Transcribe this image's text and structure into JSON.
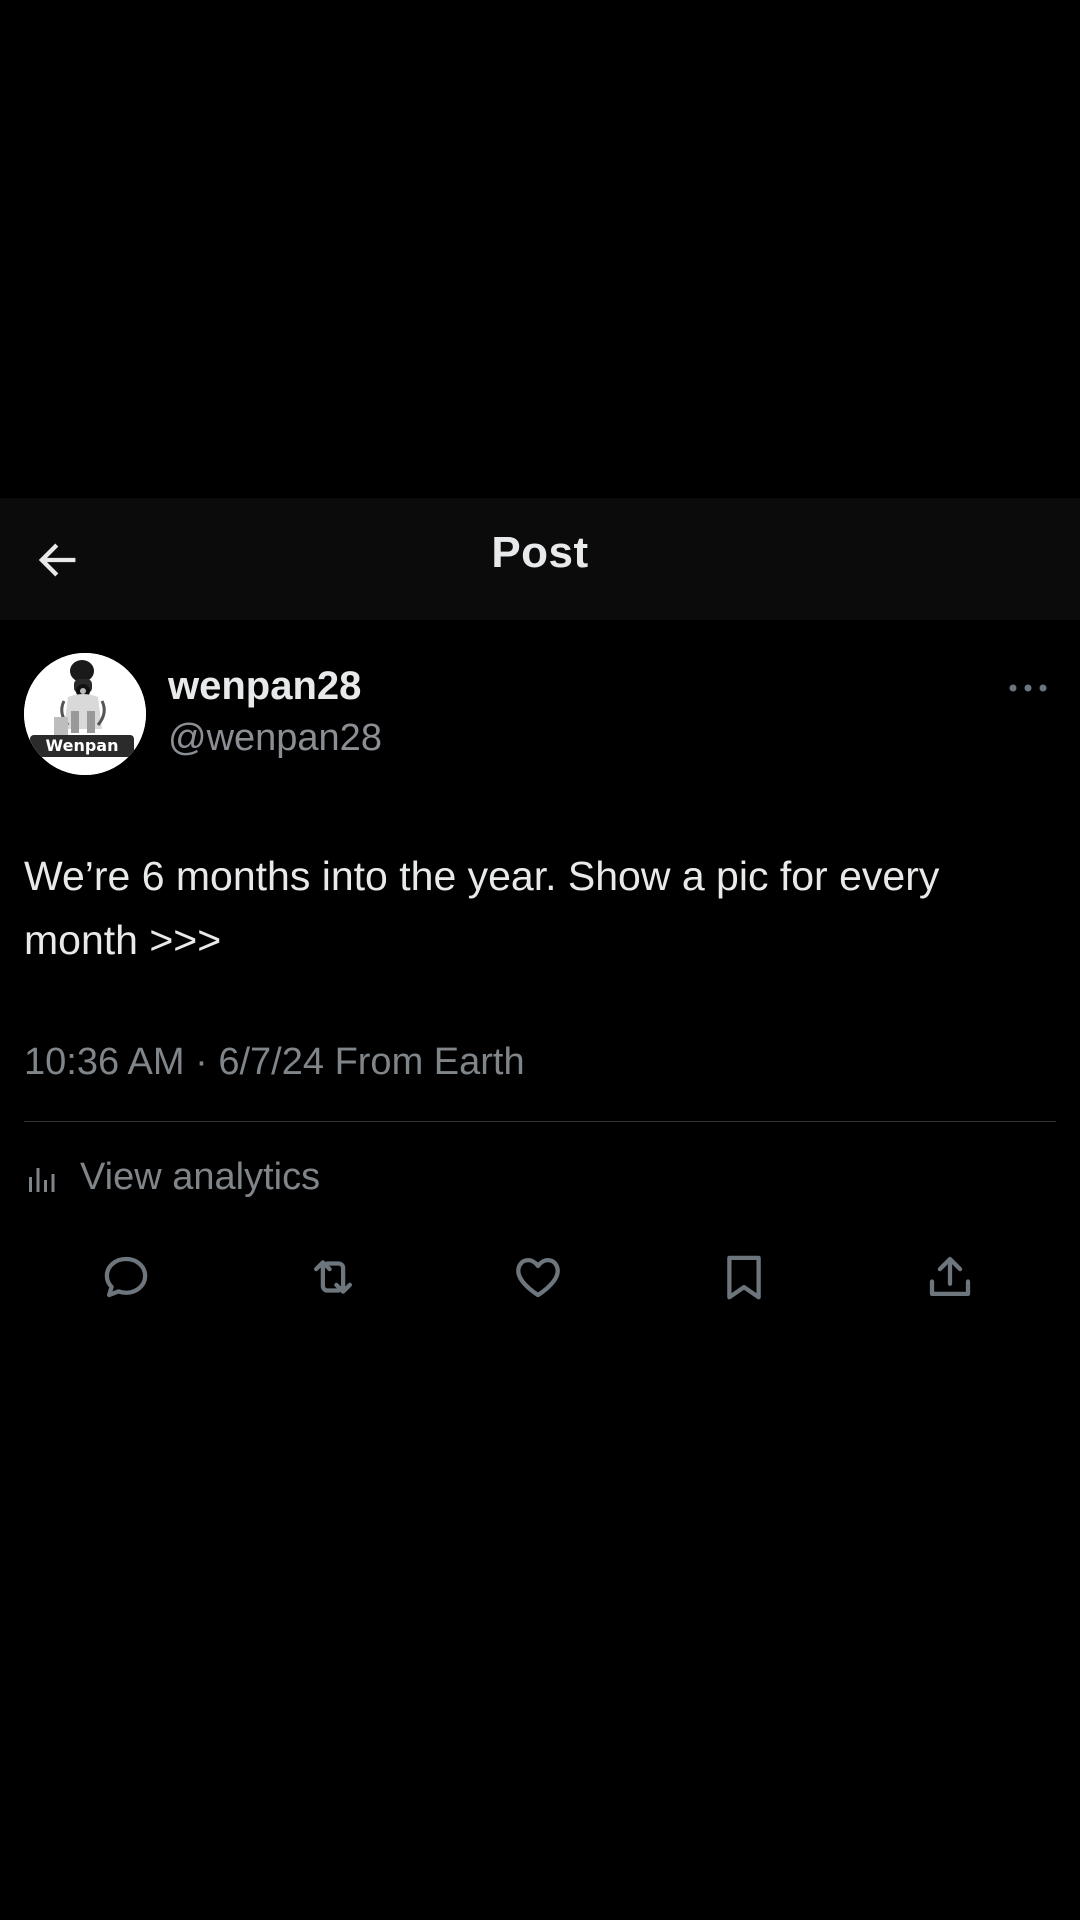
{
  "header": {
    "title": "Post",
    "back_icon": "arrow-left-icon"
  },
  "author": {
    "display_name": "wenpan28",
    "handle": "@wenpan28",
    "avatar_text": "Wenpan"
  },
  "post": {
    "text": "We’re 6 months into the year. Show a pic for every month >>>",
    "time": "10:36 AM",
    "separator": "·",
    "date": "6/7/24",
    "source": "From Earth"
  },
  "analytics": {
    "label": "View analytics",
    "icon": "bar-chart-icon"
  },
  "actions": [
    {
      "name": "reply",
      "icon": "reply-icon"
    },
    {
      "name": "repost",
      "icon": "repost-icon"
    },
    {
      "name": "like",
      "icon": "heart-icon"
    },
    {
      "name": "bookmark",
      "icon": "bookmark-icon"
    },
    {
      "name": "share",
      "icon": "share-icon"
    }
  ],
  "colors": {
    "background": "#000000",
    "header_background": "#0b0b0b",
    "primary_text": "#e7e9ea",
    "secondary_text": "#80858a",
    "icon_gray": "#6e767d",
    "divider": "#2f3336"
  }
}
